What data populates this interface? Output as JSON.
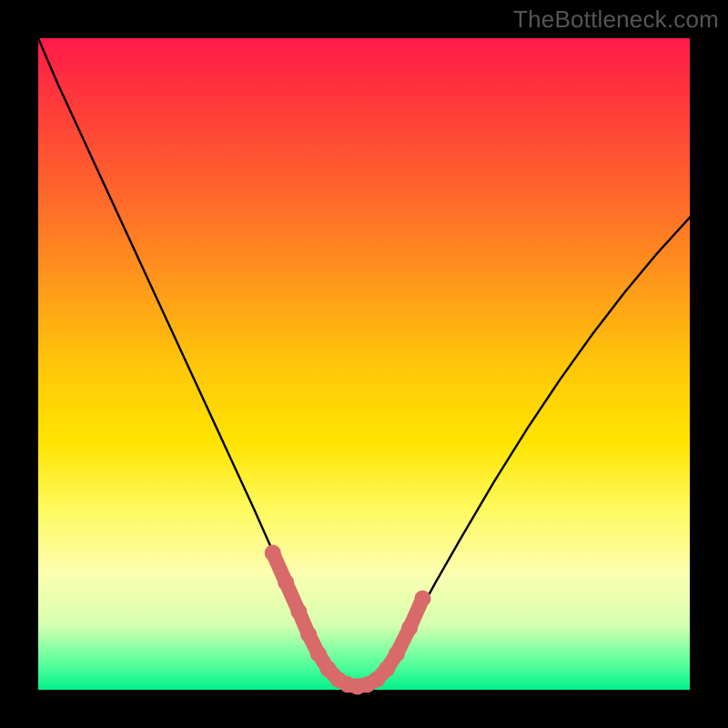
{
  "watermark": "TheBottleneck.com",
  "chart_data": {
    "type": "line",
    "title": "",
    "xlabel": "",
    "ylabel": "",
    "xlim": [
      0,
      100
    ],
    "ylim": [
      0,
      100
    ],
    "series": [
      {
        "name": "curve",
        "color": "#000000",
        "x": [
          0,
          3,
          6,
          9,
          12,
          15,
          18,
          21,
          24,
          27,
          30,
          33,
          35,
          37,
          39,
          41,
          43,
          45,
          47,
          49,
          51,
          53,
          55,
          58,
          61,
          65,
          70,
          75,
          80,
          85,
          90,
          95,
          100
        ],
        "y": [
          100,
          93,
          86.5,
          80,
          73.5,
          67,
          60.5,
          54,
          47.5,
          41,
          34.5,
          28,
          23.5,
          19,
          14.5,
          10,
          6,
          3,
          1.2,
          0.5,
          1.2,
          3,
          6,
          11,
          16.5,
          23.5,
          32,
          40,
          47.5,
          54.5,
          61,
          67,
          72.5
        ]
      },
      {
        "name": "highlight",
        "color": "#d86a6a",
        "x": [
          36,
          38,
          40,
          41.5,
          43,
          44.5,
          46,
          47.5,
          49,
          50.5,
          52,
          53.5,
          55,
          57,
          59
        ],
        "y": [
          21,
          16.5,
          12,
          8.5,
          5.5,
          3.2,
          1.6,
          0.8,
          0.5,
          0.8,
          1.6,
          3.2,
          5.5,
          9.5,
          14
        ]
      }
    ]
  }
}
